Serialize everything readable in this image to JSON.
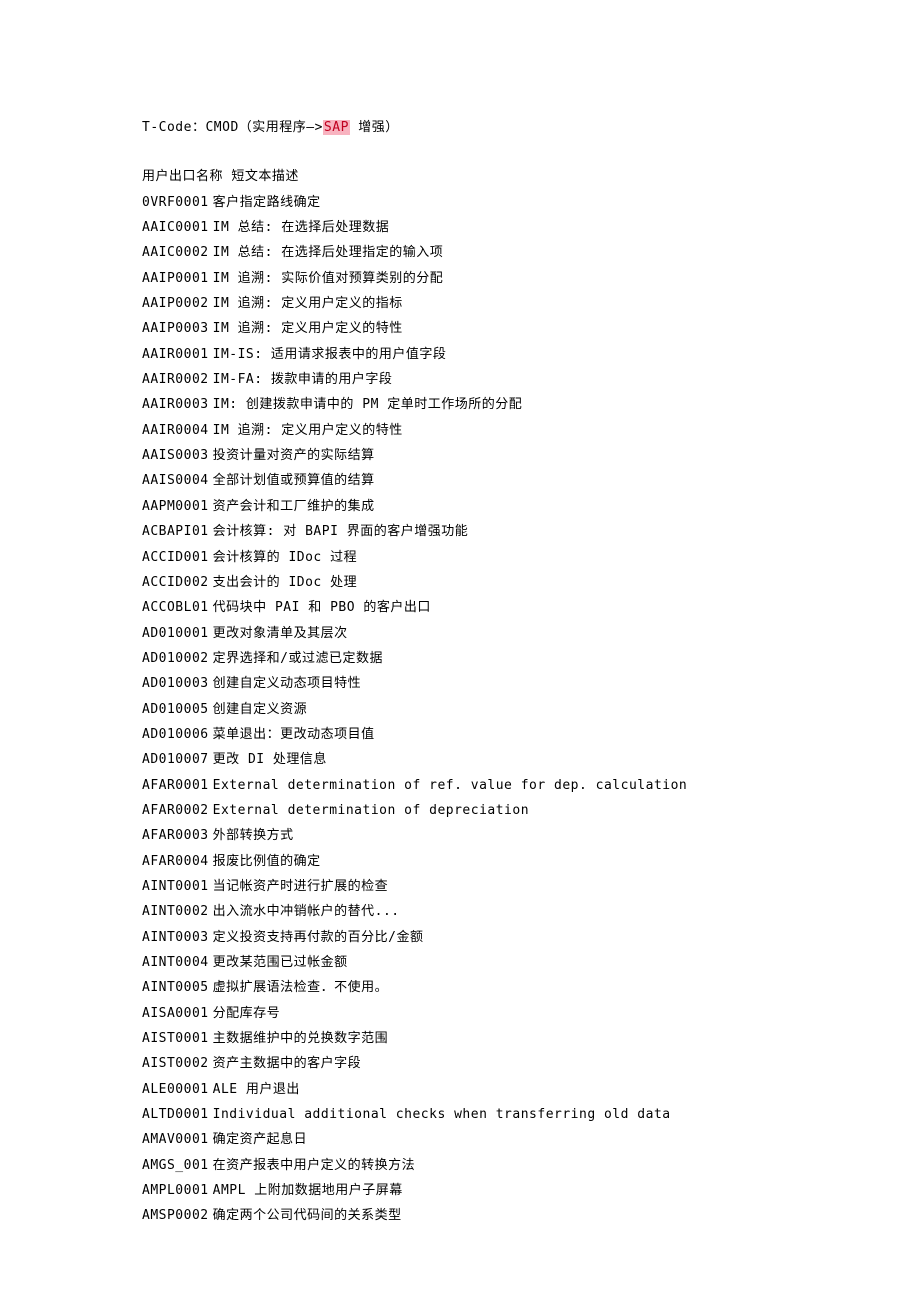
{
  "title_prefix": "T-Code：CMOD（实用程序—>",
  "title_highlight": "SAP",
  "title_suffix": " 增强）",
  "header": "用户出口名称 短文本描述",
  "rows": [
    {
      "code": "0VRF0001",
      "desc": "客户指定路线确定"
    },
    {
      "code": "AAIC0001",
      "desc": "IM 总结: 在选择后处理数据"
    },
    {
      "code": "AAIC0002",
      "desc": "IM 总结: 在选择后处理指定的输入项"
    },
    {
      "code": "AAIP0001",
      "desc": "IM 追溯: 实际价值对预算类别的分配"
    },
    {
      "code": "AAIP0002",
      "desc": "IM 追溯: 定义用户定义的指标"
    },
    {
      "code": "AAIP0003",
      "desc": "IM 追溯: 定义用户定义的特性"
    },
    {
      "code": "AAIR0001",
      "desc": "IM-IS: 适用请求报表中的用户值字段"
    },
    {
      "code": "AAIR0002",
      "desc": "IM-FA: 拨款申请的用户字段"
    },
    {
      "code": "AAIR0003",
      "desc": "IM: 创建拨款申请中的 PM 定单时工作场所的分配"
    },
    {
      "code": "AAIR0004",
      "desc": "IM 追溯: 定义用户定义的特性"
    },
    {
      "code": "AAIS0003",
      "desc": "投资计量对资产的实际结算"
    },
    {
      "code": "AAIS0004",
      "desc": "全部计划值或预算值的结算"
    },
    {
      "code": "AAPM0001",
      "desc": "资产会计和工厂维护的集成"
    },
    {
      "code": "ACBAPI01",
      "desc": "会计核算: 对 BAPI 界面的客户增强功能"
    },
    {
      "code": "ACCID001",
      "desc": "会计核算的 IDoc 过程"
    },
    {
      "code": "ACCID002",
      "desc": "支出会计的 IDoc 处理"
    },
    {
      "code": "ACCOBL01",
      "desc": "代码块中 PAI 和 PBO 的客户出口"
    },
    {
      "code": "AD010001",
      "desc": "更改对象清单及其层次"
    },
    {
      "code": "AD010002",
      "desc": "定界选择和/或过滤已定数据"
    },
    {
      "code": "AD010003",
      "desc": "创建自定义动态项目特性"
    },
    {
      "code": "AD010005",
      "desc": "创建自定义资源"
    },
    {
      "code": "AD010006",
      "desc": "菜单退出：更改动态项目值"
    },
    {
      "code": "AD010007",
      "desc": "更改 DI 处理信息"
    },
    {
      "code": "AFAR0001",
      "desc": "External determination of ref. value for dep. calculation"
    },
    {
      "code": "AFAR0002",
      "desc": "External determination of depreciation"
    },
    {
      "code": "AFAR0003",
      "desc": "外部转换方式"
    },
    {
      "code": "AFAR0004",
      "desc": "报废比例值的确定"
    },
    {
      "code": "AINT0001",
      "desc": "当记帐资产时进行扩展的检查"
    },
    {
      "code": "AINT0002",
      "desc": "出入流水中冲销帐户的替代..."
    },
    {
      "code": "AINT0003",
      "desc": "定义投资支持再付款的百分比/金额"
    },
    {
      "code": "AINT0004",
      "desc": "更改某范围已过帐金额"
    },
    {
      "code": "AINT0005",
      "desc": "虚拟扩展语法检查．不使用。"
    },
    {
      "code": "AISA0001",
      "desc": "分配库存号"
    },
    {
      "code": "AIST0001",
      "desc": "主数据维护中的兑换数字范围"
    },
    {
      "code": "AIST0002",
      "desc": "资产主数据中的客户字段"
    },
    {
      "code": "ALE00001",
      "desc": "ALE 用户退出"
    },
    {
      "code": "ALTD0001",
      "desc": "Individual additional checks when transferring old data"
    },
    {
      "code": "AMAV0001",
      "desc": "确定资产起息日"
    },
    {
      "code": "AMGS_001",
      "desc": "在资产报表中用户定义的转换方法"
    },
    {
      "code": "AMPL0001",
      "desc": "AMPL 上附加数据地用户子屏幕"
    },
    {
      "code": "AMSP0002",
      "desc": "确定两个公司代码间的关系类型"
    }
  ]
}
